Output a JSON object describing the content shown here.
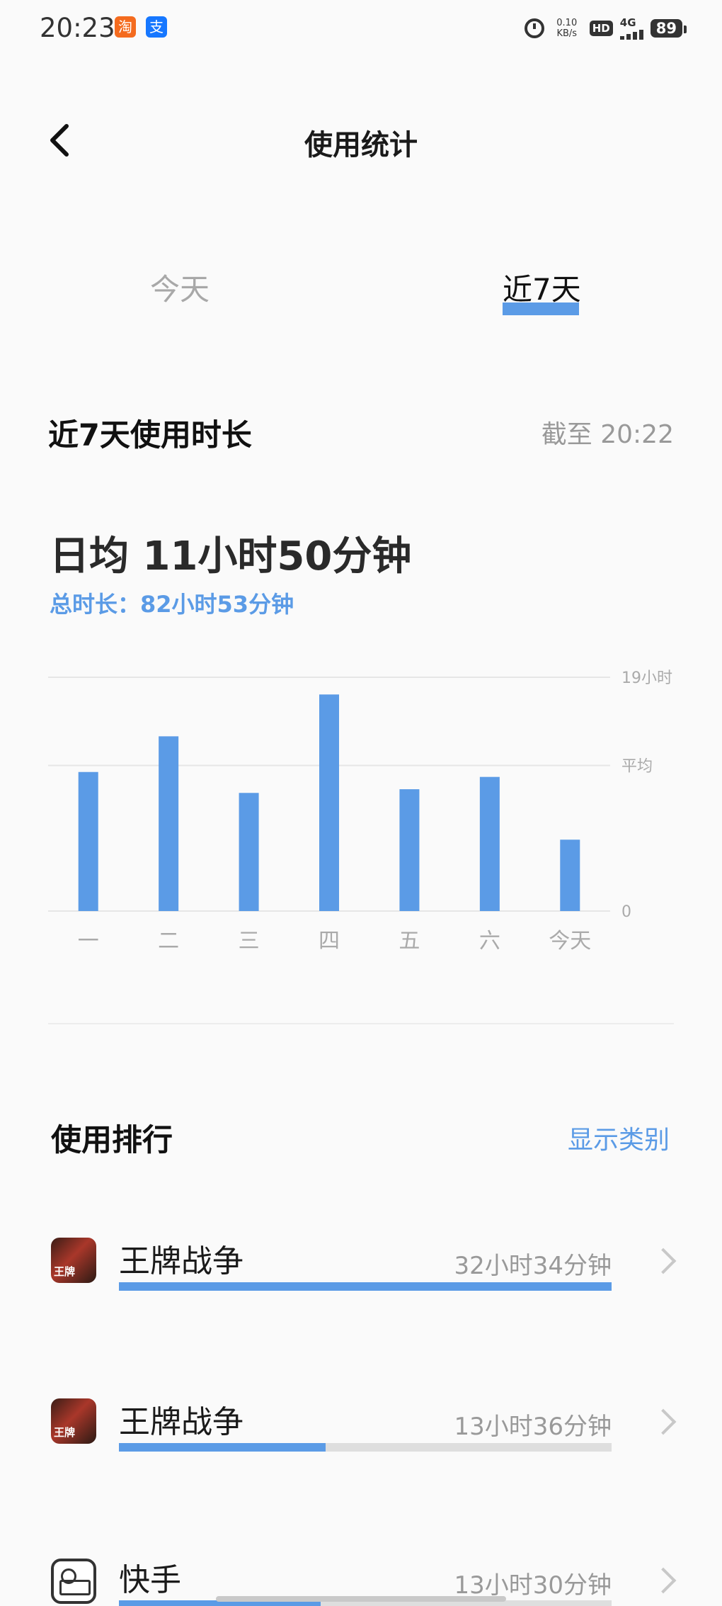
{
  "status_bar": {
    "time": "20:23",
    "taobao_glyph": "淘",
    "alipay_glyph": "支",
    "net_speed_value": "0.10",
    "net_speed_unit": "KB/s",
    "hd": "HD",
    "network": "4G",
    "battery": "89"
  },
  "header": {
    "title": "使用统计"
  },
  "tabs": [
    {
      "label": "今天",
      "selected": false
    },
    {
      "label": "近7天",
      "selected": true
    }
  ],
  "summary": {
    "title": "近7天使用时长",
    "as_of": "截至 20:22",
    "daily_average": "日均 11小时50分钟",
    "total": "总时长：82小时53分钟"
  },
  "chart_data": {
    "type": "bar",
    "categories": [
      "一",
      "二",
      "三",
      "四",
      "五",
      "六",
      "今天"
    ],
    "values": [
      11.3,
      14.2,
      9.6,
      17.6,
      9.9,
      10.9,
      5.8
    ],
    "unit": "小时",
    "ylim": [
      0,
      19
    ],
    "y_tick_labels": [
      {
        "value": 19,
        "label": "19小时"
      },
      {
        "value": 11.83,
        "label": "平均"
      },
      {
        "value": 0,
        "label": "0"
      }
    ],
    "bar_color": "#5b9be6",
    "grid": true
  },
  "ranking": {
    "title": "使用排行",
    "show_category": "显示类别",
    "items": [
      {
        "name": "王牌战争",
        "duration": "32小时34分钟",
        "share": 1.0,
        "icon": "game-icon"
      },
      {
        "name": "王牌战争",
        "duration": "13小时36分钟",
        "share": 0.42,
        "icon": "game-icon"
      },
      {
        "name": "快手",
        "duration": "13小时30分钟",
        "share": 0.41,
        "icon": "kuaishou-icon"
      }
    ]
  },
  "colors": {
    "accent": "#5b9be6",
    "inactive_tab": "#a8a8a8",
    "muted_text": "#999999"
  }
}
